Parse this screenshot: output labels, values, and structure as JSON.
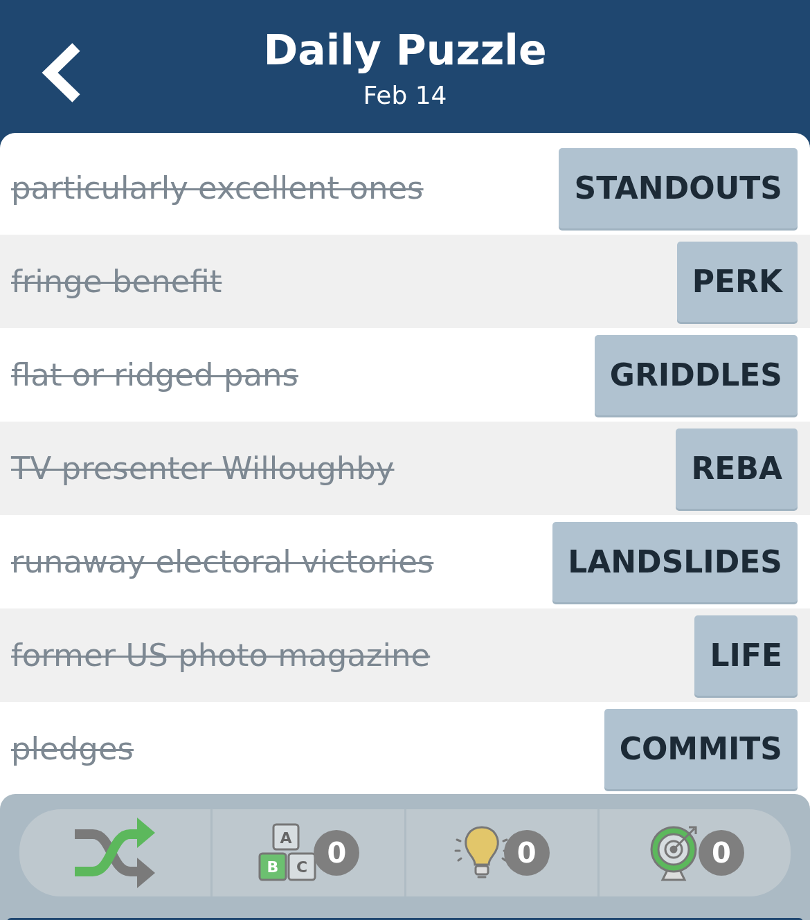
{
  "header": {
    "title": "Daily Puzzle",
    "date": "Feb 14"
  },
  "clues": [
    {
      "clue": "particularly excellent ones",
      "answer": "STANDOUTS",
      "solved": true
    },
    {
      "clue": "fringe benefit",
      "answer": "PERK",
      "solved": true
    },
    {
      "clue": "flat or ridged pans",
      "answer": "GRIDDLES",
      "solved": true
    },
    {
      "clue": "TV presenter Willoughby",
      "answer": "REBA",
      "solved": true
    },
    {
      "clue": "runaway electoral victories",
      "answer": "LANDSLIDES",
      "solved": true
    },
    {
      "clue": "former US photo magazine",
      "answer": "LIFE",
      "solved": true
    },
    {
      "clue": "pledges",
      "answer": "COMMITS",
      "solved": true
    }
  ],
  "toolbar": [
    {
      "kind": "shuffle"
    },
    {
      "kind": "letters",
      "count": "0",
      "blocks": [
        "A",
        "B",
        "C"
      ]
    },
    {
      "kind": "hint",
      "count": "0"
    },
    {
      "kind": "target",
      "count": "0"
    }
  ]
}
